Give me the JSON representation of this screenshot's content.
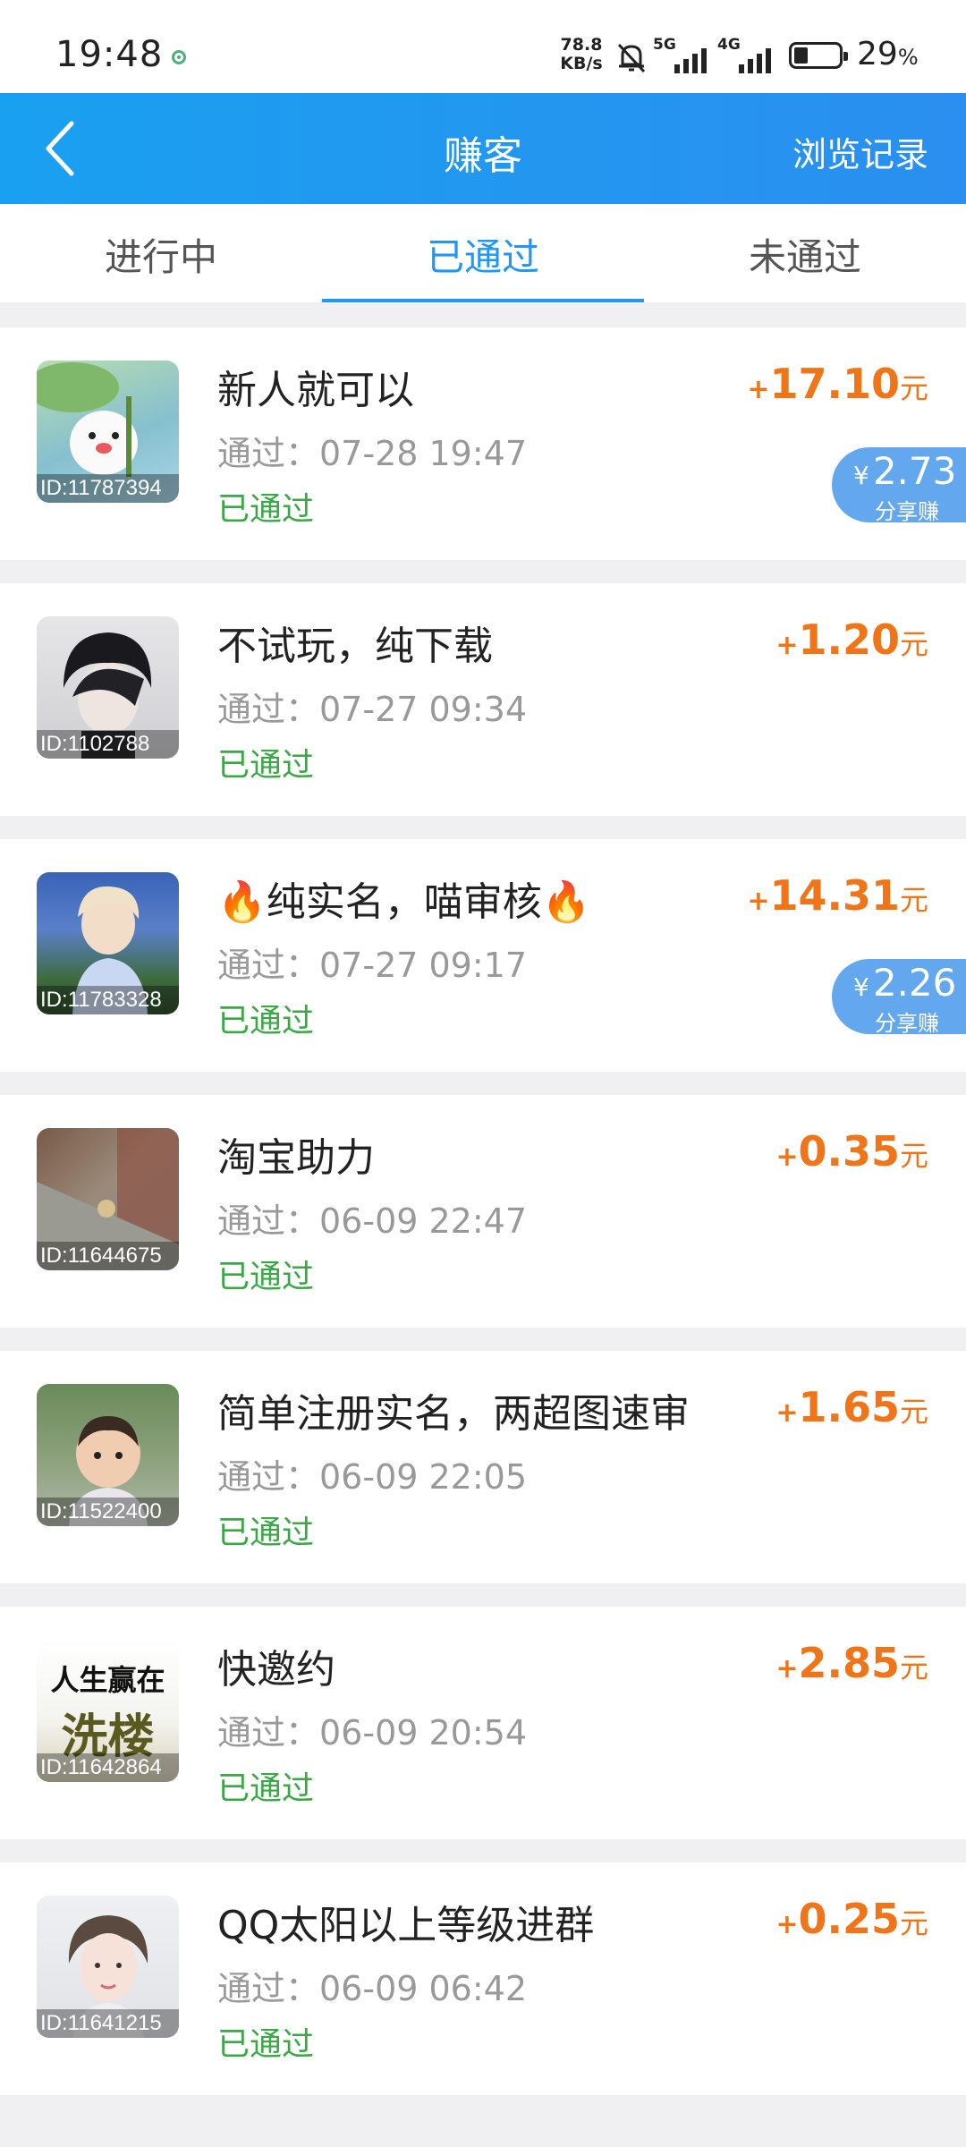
{
  "status_bar": {
    "time": "19:48",
    "speed_value": "78.8",
    "speed_unit": "KB/s",
    "net_5g": "5G",
    "net_4g": "4G",
    "battery_pct": "29",
    "battery_sign": "%"
  },
  "header": {
    "title": "赚客",
    "history_label": "浏览记录"
  },
  "tabs": [
    {
      "label": "进行中",
      "active": false
    },
    {
      "label": "已通过",
      "active": true
    },
    {
      "label": "未通过",
      "active": false
    }
  ],
  "tasks": [
    {
      "title": "新人就可以",
      "meta": "通过：07-28 19:47",
      "status": "已通过",
      "amount_sign": "+",
      "amount": "17.10",
      "unit": "元",
      "id": "ID:11787394",
      "share_amount": "2.73",
      "share_label": "分享赚"
    },
    {
      "title": "不试玩，纯下载",
      "meta": "通过：07-27 09:34",
      "status": "已通过",
      "amount_sign": "+",
      "amount": "1.20",
      "unit": "元",
      "id": "ID:1102788"
    },
    {
      "title": "🔥纯实名，喵审核🔥",
      "meta": "通过：07-27 09:17",
      "status": "已通过",
      "amount_sign": "+",
      "amount": "14.31",
      "unit": "元",
      "id": "ID:11783328",
      "share_amount": "2.26",
      "share_label": "分享赚"
    },
    {
      "title": "淘宝助力",
      "meta": "通过：06-09 22:47",
      "status": "已通过",
      "amount_sign": "+",
      "amount": "0.35",
      "unit": "元",
      "id": "ID:11644675"
    },
    {
      "title": "简单注册实名，两超图速审",
      "meta": "通过：06-09 22:05",
      "status": "已通过",
      "amount_sign": "+",
      "amount": "1.65",
      "unit": "元",
      "id": "ID:11522400"
    },
    {
      "title": "快邀约",
      "meta": "通过：06-09 20:54",
      "status": "已通过",
      "amount_sign": "+",
      "amount": "2.85",
      "unit": "元",
      "id": "ID:11642864",
      "thumb_text": "人生赢在",
      "thumb_text2": "洗楼"
    },
    {
      "title": "QQ太阳以上等级进群",
      "meta": "通过：06-09 06:42",
      "status": "已通过",
      "amount_sign": "+",
      "amount": "0.25",
      "unit": "元",
      "id": "ID:11641215"
    }
  ],
  "share_currency": "¥",
  "colors": {
    "accent": "#2196f3",
    "amount": "#f07418",
    "status_passed": "#3aa844",
    "share_badge": "#63a7ee"
  }
}
